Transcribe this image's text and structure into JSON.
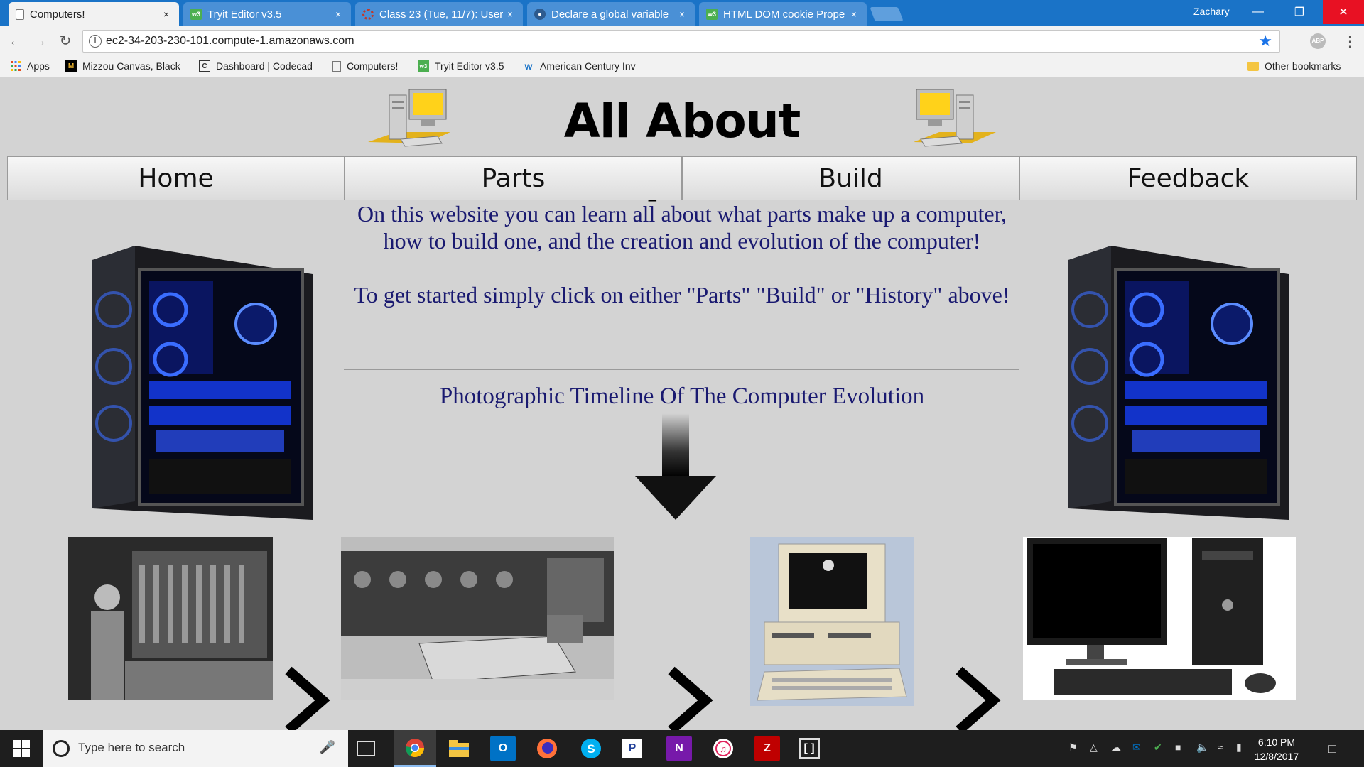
{
  "browser": {
    "tabs": [
      {
        "title": "Computers!",
        "active": true,
        "icon": "page-icon"
      },
      {
        "title": "Tryit Editor v3.5",
        "active": false,
        "icon": "w3schools-icon"
      },
      {
        "title": "Class 23 (Tue, 11/7): User",
        "active": false,
        "icon": "class-icon"
      },
      {
        "title": "Declare a global variable",
        "active": false,
        "icon": "stackoverflow-icon"
      },
      {
        "title": "HTML DOM cookie Prope",
        "active": false,
        "icon": "w3schools-icon"
      }
    ],
    "close_glyph": "×",
    "profile_name": "Zachary",
    "url": "ec2-34-203-230-101.compute-1.amazonaws.com",
    "abp_label": "ABP",
    "bookmarks": [
      {
        "label": "Apps",
        "icon": "apps-icon"
      },
      {
        "label": "Mizzou Canvas, Black",
        "icon": "mizzou-icon"
      },
      {
        "label": "Dashboard | Codecad",
        "icon": "codecademy-icon"
      },
      {
        "label": "Computers!",
        "icon": "page-icon"
      },
      {
        "label": "Tryit Editor v3.5",
        "icon": "w3schools-icon"
      },
      {
        "label": "American Century Inv",
        "icon": "american-century-icon"
      }
    ],
    "other_bookmarks": "Other bookmarks"
  },
  "site": {
    "title": "All About Computers!",
    "nav": [
      "Home",
      "Parts",
      "Build",
      "Feedback"
    ],
    "intro_1": "On this website you can learn all about what parts make up a computer, how to build one, and the creation and evolution of the computer!",
    "intro_2": "To get started simply click on either \"Parts\" \"Build\" or \"History\" above!",
    "timeline_title": "Photographic Timeline Of The Computer Evolution",
    "text_color": "#191970",
    "background_color": "#d3d3d3"
  },
  "taskbar": {
    "search_placeholder": "Type here to search",
    "time": "6:10 PM",
    "date": "12/8/2017",
    "apps": [
      "chrome-icon",
      "file-explorer-icon",
      "outlook-icon",
      "firefox-icon",
      "skype-icon",
      "pandora-icon",
      "onenote-icon",
      "itunes-icon",
      "filezilla-icon",
      "brackets-icon"
    ]
  }
}
